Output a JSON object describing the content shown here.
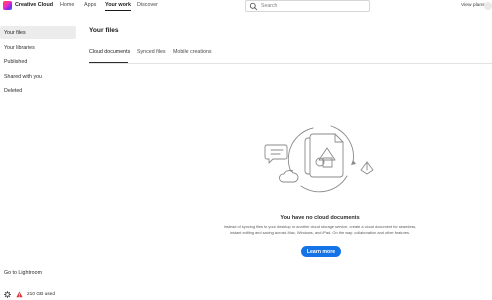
{
  "header": {
    "app_name": "Creative Cloud",
    "nav": [
      "Home",
      "Apps",
      "Your work",
      "Discover"
    ],
    "active_nav": "Your work",
    "search_placeholder": "Search",
    "view_plans": "View plans"
  },
  "sidebar": {
    "items": [
      {
        "label": "Your files",
        "active": true
      },
      {
        "label": "Your libraries",
        "active": false
      },
      {
        "label": "Published",
        "active": false
      },
      {
        "label": "Shared with you",
        "active": false
      },
      {
        "label": "Deleted",
        "active": false
      }
    ],
    "go_to_lightroom": "Go to Lightroom",
    "storage_used": "210 GB used"
  },
  "main": {
    "title": "Your files",
    "tabs": [
      {
        "label": "Cloud documents",
        "active": true
      },
      {
        "label": "Synced files",
        "active": false
      },
      {
        "label": "Mobile creations",
        "active": false
      }
    ],
    "empty_state": {
      "title": "You have no cloud documents",
      "description": "Instead of syncing files to your desktop or another cloud storage service, create a cloud document for seamless, instant editing and saving across Mac, Windows, and iPad. On the way: collaboration and other features.",
      "button": "Learn more"
    }
  },
  "colors": {
    "accent": "#1473e6",
    "warning": "#d7373f",
    "active_bg": "#ececec"
  },
  "icons": [
    "creative-cloud-logo",
    "search-icon",
    "help-icon",
    "gear-icon",
    "warning-icon",
    "cloud-documents-illustration"
  ]
}
